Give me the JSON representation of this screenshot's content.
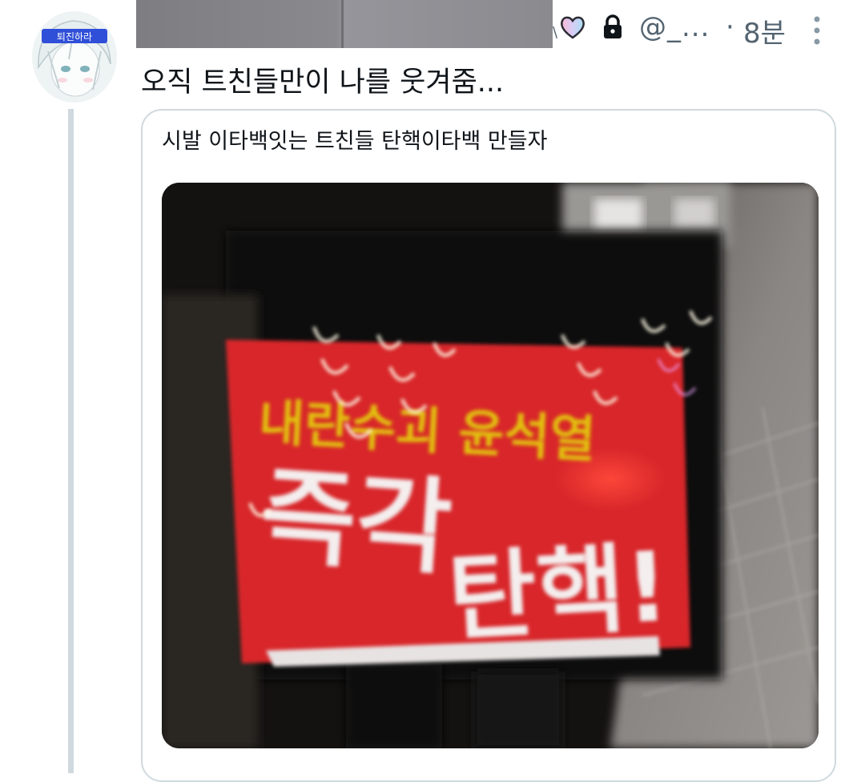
{
  "author": {
    "avatar_text": "퇴진하라",
    "handle": "@_...",
    "separator": "·",
    "time": "8분",
    "badge_icon": "heart-icon",
    "protected_icon": "lock-icon",
    "redaction_mark": "\\"
  },
  "tweet": {
    "text": "오직 트친들만이 나를 웃겨줌..."
  },
  "quote": {
    "text": "시발 이타백잇는 트친들 탄핵이타백 만들자",
    "media": {
      "sign_line1": "내란수괴 윤석열",
      "sign_line2": "즉각",
      "sign_line3": "탄핵!"
    }
  },
  "colors": {
    "text_primary": "#0f1419",
    "text_secondary": "#536471",
    "border": "#cfd9de",
    "sign_red": "#d8262a",
    "sign_yellow": "#e2c10e"
  }
}
